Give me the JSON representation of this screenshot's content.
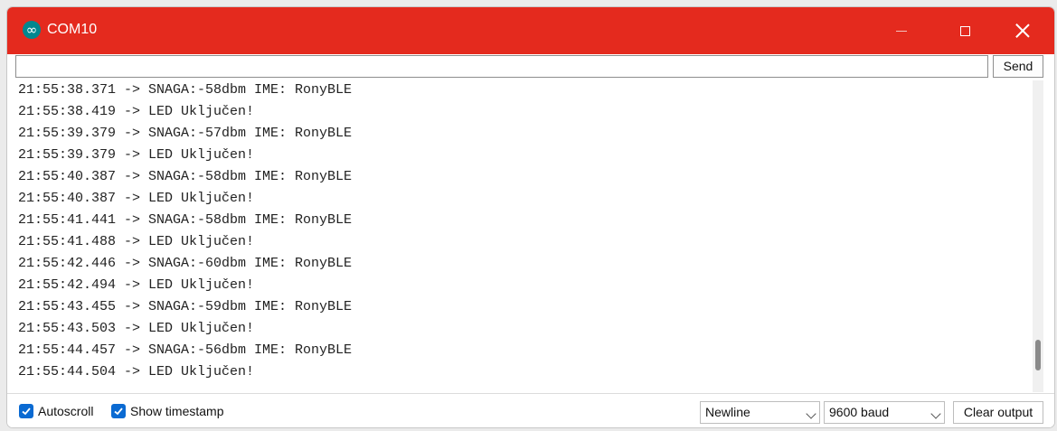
{
  "window": {
    "title": "COM10",
    "app_icon_glyph": "∞",
    "titlebar_color": "#e42a1e"
  },
  "send_bar": {
    "input_value": "",
    "send_label": "Send"
  },
  "output": {
    "lines": [
      "21:55:38.371 -> SNAGA:-58dbm IME: RonyBLE",
      "21:55:38.419 -> LED Uključen!",
      "21:55:39.379 -> SNAGA:-57dbm IME: RonyBLE",
      "21:55:39.379 -> LED Uključen!",
      "21:55:40.387 -> SNAGA:-58dbm IME: RonyBLE",
      "21:55:40.387 -> LED Uključen!",
      "21:55:41.441 -> SNAGA:-58dbm IME: RonyBLE",
      "21:55:41.488 -> LED Uključen!",
      "21:55:42.446 -> SNAGA:-60dbm IME: RonyBLE",
      "21:55:42.494 -> LED Uključen!",
      "21:55:43.455 -> SNAGA:-59dbm IME: RonyBLE",
      "21:55:43.503 -> LED Uključen!",
      "21:55:44.457 -> SNAGA:-56dbm IME: RonyBLE",
      "21:55:44.504 -> LED Uključen!"
    ]
  },
  "bottom": {
    "autoscroll_label": "Autoscroll",
    "autoscroll_checked": true,
    "timestamp_label": "Show timestamp",
    "timestamp_checked": true,
    "line_ending_value": "Newline",
    "baud_value": "9600 baud",
    "clear_label": "Clear output"
  }
}
